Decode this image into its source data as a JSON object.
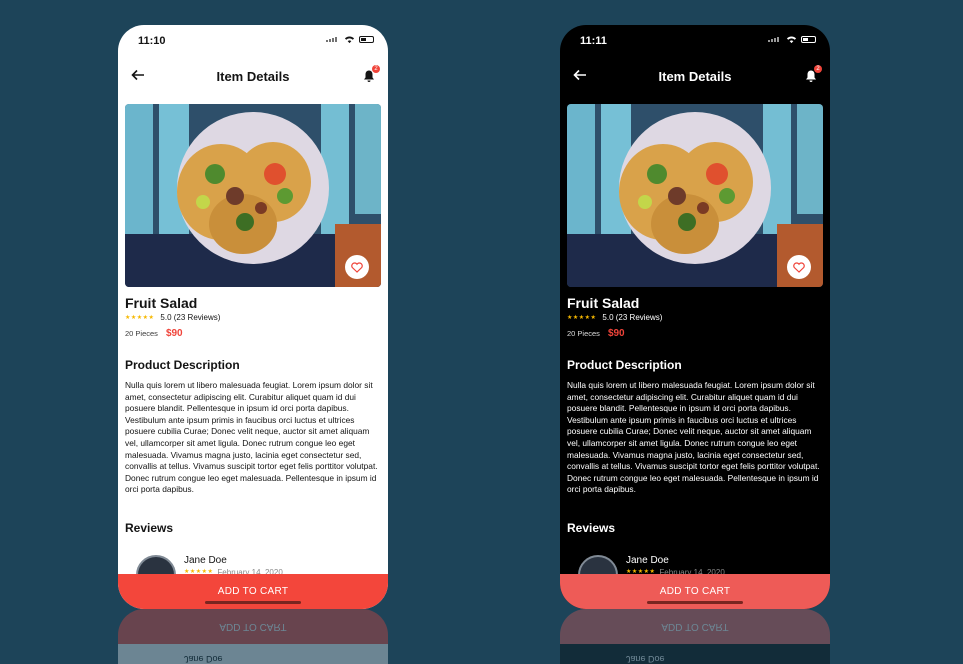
{
  "light": {
    "time": "11:10",
    "title": "Item Details",
    "notification_count": "2"
  },
  "dark": {
    "time": "11:11",
    "title": "Item Details",
    "notification_count": "2"
  },
  "product": {
    "name": "Fruit Salad",
    "stars": "★★★★★",
    "rating": "5.0 (23 Reviews)",
    "pieces": "20 Pieces",
    "price": "$90",
    "description_heading": "Product Description",
    "description": "Nulla quis lorem ut libero malesuada feugiat. Lorem ipsum dolor sit amet, consectetur adipiscing elit. Curabitur aliquet quam id dui posuere blandit. Pellentesque in ipsum id orci porta dapibus. Vestibulum ante ipsum primis in faucibus orci luctus et ultrices posuere cubilia Curae; Donec velit neque, auctor sit amet aliquam vel, ullamcorper sit amet ligula. Donec rutrum congue leo eget malesuada. Vivamus magna justo, lacinia eget consectetur sed, convallis at tellus. Vivamus suscipit tortor eget felis porttitor volutpat. Donec rutrum congue leo eget malesuada. Pellentesque in ipsum id orci porta dapibus.",
    "reviews_heading": "Reviews"
  },
  "review": {
    "name": "Jane Doe",
    "stars": "★★★★★",
    "date": "February 14, 2020"
  },
  "cart_label": "ADD TO CART",
  "icons": [
    "back-arrow-icon",
    "bell-icon",
    "heart-icon",
    "wifi-icon",
    "battery-icon",
    "signal-icon"
  ],
  "colors": {
    "accent": "#f3463b",
    "background": "#1d4459",
    "star": "#f6b800"
  }
}
